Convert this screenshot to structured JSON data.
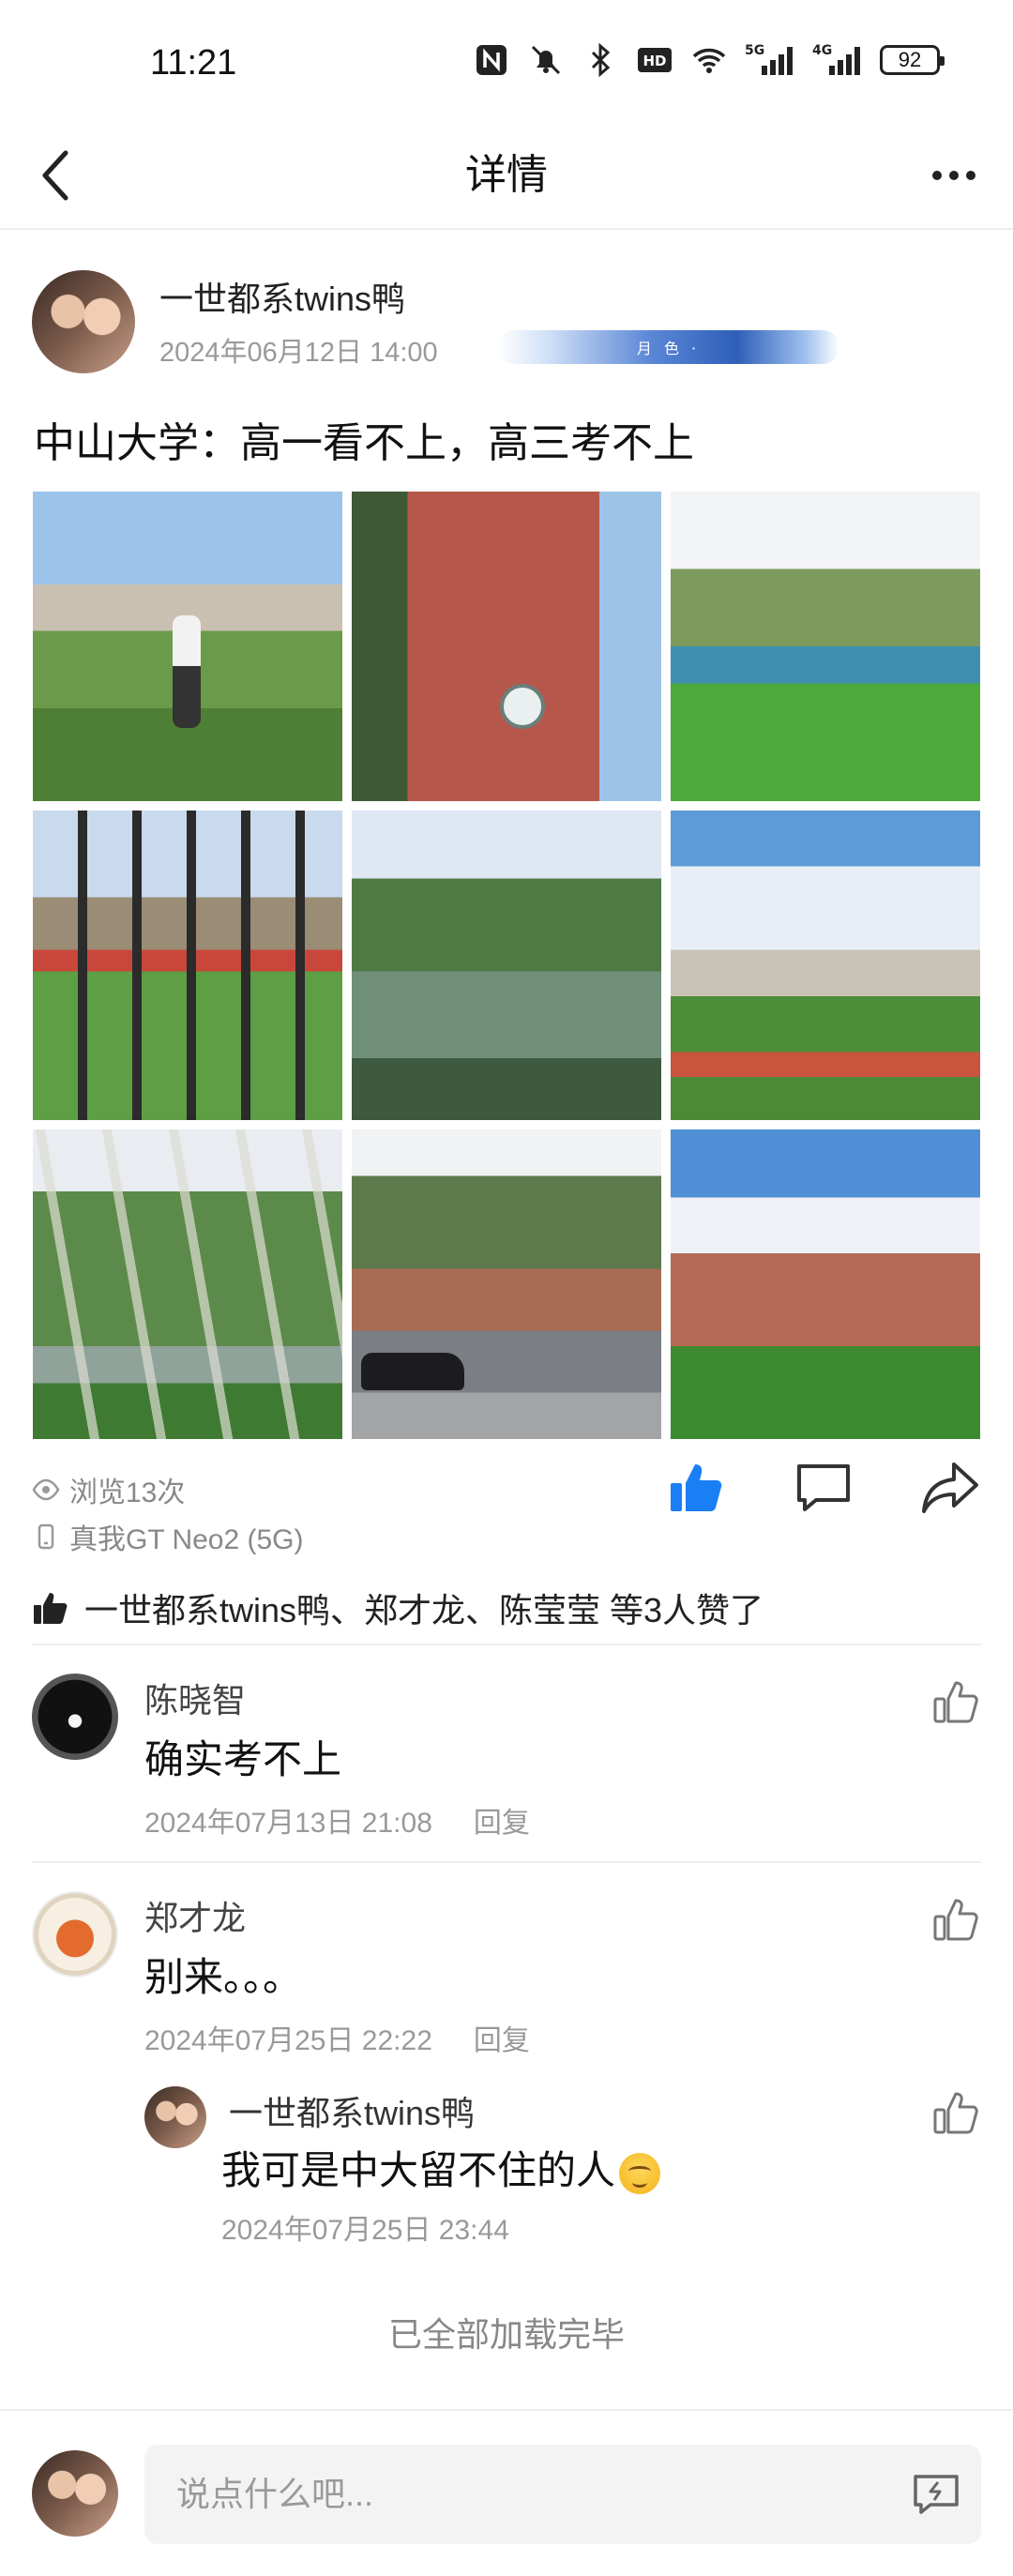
{
  "status_bar": {
    "time": "11:21",
    "net_5g": "5G",
    "net_4g": "4G",
    "battery": "92",
    "icons": [
      "nfc-icon",
      "mute-icon",
      "bluetooth-icon",
      "hd-icon",
      "wifi-icon",
      "signal-5g-icon",
      "signal-4g-icon",
      "battery-icon"
    ]
  },
  "header": {
    "title": "详情",
    "back_icon": "back-arrow-icon",
    "more_icon": "more-dots-icon"
  },
  "post": {
    "author": "一世都系twins鸭",
    "time": "2024年06月12日 14:00",
    "medal_text": "月 色 ·",
    "text": "中山大学：高一看不上，高三考不上",
    "photo_count": 9
  },
  "stats": {
    "views": "浏览13次",
    "device": "真我GT Neo2 (5G)"
  },
  "actions": {
    "like_color": "#1a7ff5",
    "icons": [
      "thumbs-up-icon",
      "comment-icon",
      "share-icon"
    ]
  },
  "likers": {
    "text": "一世都系twins鸭、郑才龙、陈莹莹 等3人赞了"
  },
  "comments": [
    {
      "name": "陈晓智",
      "text": "确实考不上",
      "time": "2024年07月13日 21:08",
      "reply_label": "回复"
    },
    {
      "name": "郑才龙",
      "text": "别来。。。",
      "time": "2024年07月25日 22:22",
      "reply_label": "回复",
      "replies": [
        {
          "name": "一世都系twins鸭",
          "text": "我可是中大留不住的人",
          "time": "2024年07月25日 23:44"
        }
      ]
    }
  ],
  "end_text": "已全部加载完毕",
  "input": {
    "placeholder": "说点什么吧..."
  }
}
